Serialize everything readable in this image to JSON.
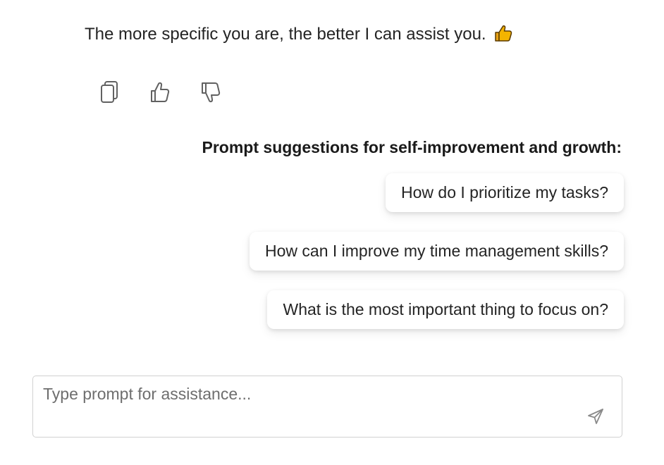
{
  "message": {
    "text": "The more specific you are, the better I can assist you.",
    "emoji_icon": "thumbs-up-emoji"
  },
  "actions": {
    "copy_icon": "copy-icon",
    "like_icon": "thumbs-up-icon",
    "dislike_icon": "thumbs-down-icon"
  },
  "suggestions": {
    "heading": "Prompt suggestions for self-improvement and growth:",
    "items": [
      "How do I prioritize my tasks?",
      "How can I improve my time management skills?",
      "What is the most important thing to focus on?"
    ]
  },
  "composer": {
    "placeholder": "Type prompt for assistance...",
    "value": "",
    "send_icon": "send-icon"
  },
  "colors": {
    "text": "#242424",
    "icon_stroke": "#616161",
    "border": "#d1d1d1",
    "emoji_yellow": "#f4b400"
  }
}
